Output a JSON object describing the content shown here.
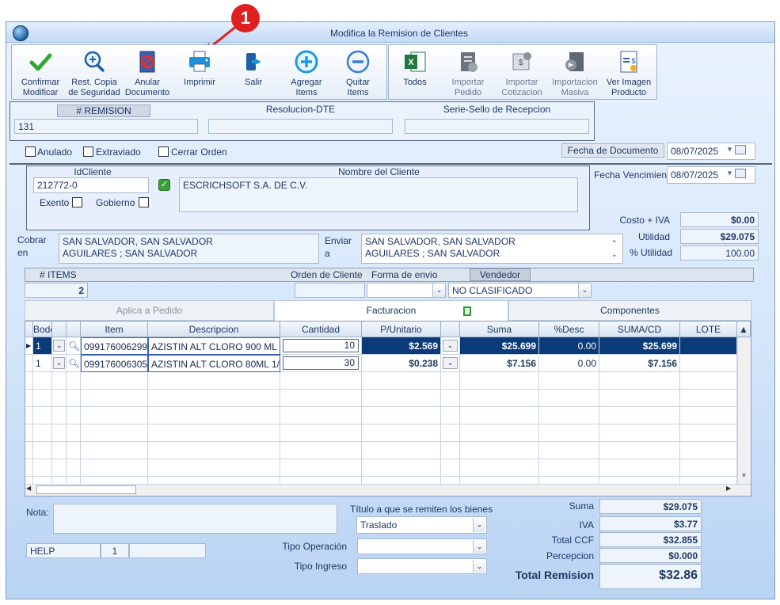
{
  "window": {
    "title": "Modifica la Remision de Clientes"
  },
  "callout": {
    "number": "1"
  },
  "toolbar": {
    "confirm": [
      "Confirmar",
      "Modificar"
    ],
    "restore": [
      "Rest. Copia",
      "de Seguridad"
    ],
    "cancel_doc": [
      "Anular",
      "Documento"
    ],
    "print": [
      "Imprimir"
    ],
    "exit": [
      "Salir"
    ],
    "add_items": [
      "Agregar",
      "Items"
    ],
    "remove_items": [
      "Quitar",
      "Items"
    ],
    "all": [
      "Todos"
    ],
    "import_order": [
      "Importar",
      "Pedido"
    ],
    "import_quote": [
      "Importar",
      "Cotizacion"
    ],
    "mass_import": [
      "Importacion",
      "Masiva"
    ],
    "view_image": [
      "Ver Imagen",
      "Producto"
    ]
  },
  "header": {
    "remision_label": "# REMISION",
    "remision_value": "131",
    "resolucion_label": "Resolucion-DTE",
    "resolucion_value": "",
    "serie_label": "Serie-Sello de Recepcion",
    "serie_value": ""
  },
  "flags": {
    "anulado": "Anulado",
    "extraviado": "Extraviado",
    "cerrar": "Cerrar Orden"
  },
  "dates": {
    "fecha_doc_label": "Fecha de  Documento",
    "fecha_doc_value": "08/07/2025",
    "fecha_venc_label": "Fecha Vencimien",
    "fecha_venc_value": "08/07/2025"
  },
  "client": {
    "id_label": "IdCliente",
    "id_value": "212772-0",
    "name_label": "Nombre del Cliente",
    "name_value": "ESCRICHSOFT S.A. DE C.V.",
    "exento": "Exento",
    "gobierno": "Gobierno"
  },
  "totals_side": {
    "costo_label": "Costo + IVA",
    "costo_value": "$0.00",
    "utilidad_label": "Utilidad",
    "utilidad_value": "$29.075",
    "putilidad_label": "% Utilidad",
    "putilidad_value": "100.00"
  },
  "address": {
    "cobrar_label": "Cobrar",
    "cobrar_label2": "en",
    "cobrar_line1": "SAN SALVADOR, SAN SALVADOR",
    "cobrar_line2": "AGUILARES ; SAN SALVADOR",
    "enviar_label": "Enviar",
    "enviar_label2": "a",
    "enviar_line1": "SAN SALVADOR, SAN SALVADOR",
    "enviar_line2": "AGUILARES ; SAN SALVADOR"
  },
  "order": {
    "items_label": "# ITEMS",
    "items_value": "2",
    "orden_label": "Orden de Cliente",
    "orden_value": "",
    "forma_label": "Forma de envio",
    "forma_value": "",
    "vendedor_label": "Vendedor",
    "vendedor_value": "NO CLASIFICADO"
  },
  "tabs": [
    "Aplica a Pedido",
    "Facturacion",
    "Componentes"
  ],
  "grid": {
    "columns": [
      "Bodega",
      "",
      "Item",
      "Descripcion",
      "Cantidad",
      "P/Unitario",
      "",
      "Suma",
      "%Desc",
      "SUMA/CD",
      "LOTE"
    ],
    "rows": [
      {
        "bodega": "1",
        "item": "099176006299",
        "descripcion": "AZISTIN ALT CLORO 900 ML",
        "cantidad": "10",
        "punitario": "$2.569",
        "suma": "$25.699",
        "desc": "0.00",
        "sumacd": "$25.699",
        "lote": ""
      },
      {
        "bodega": "1",
        "item": "099176006305",
        "descripcion": "AZISTIN ALT CLORO 80ML 1/",
        "cantidad": "30",
        "punitario": "$0.238",
        "suma": "$7.156",
        "desc": "0.00",
        "sumacd": "$7.156",
        "lote": ""
      }
    ]
  },
  "footer": {
    "nota_label": "Nota:",
    "nota_value": "",
    "titulo_label": "Título a que se remiten los bienes",
    "titulo_value": "Traslado",
    "tipo_op_label": "Tipo Operación",
    "tipo_op_value": "",
    "tipo_ing_label": "Tipo Ingreso",
    "tipo_ing_value": "",
    "help_label": "HELP",
    "help_num": "1",
    "suma_label": "Suma",
    "suma_value": "$29.075",
    "iva_label": "IVA",
    "iva_value": "$3.77",
    "totalccf_label": "Total CCF",
    "totalccf_value": "$32.855",
    "percepcion_label": "Percepcion",
    "percepcion_value": "$0.000",
    "total_label": "Total Remision",
    "total_value": "$32.86"
  },
  "colors": {
    "accent": "#0b3a78",
    "window_bg": "#d5e6fb",
    "callout": "#e02020"
  }
}
